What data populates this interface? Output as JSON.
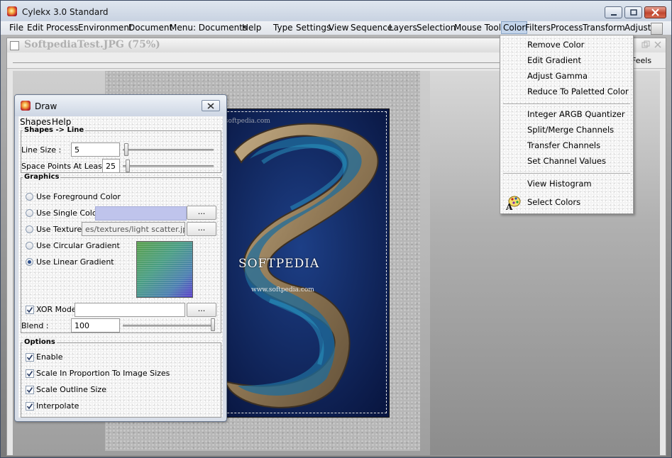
{
  "app": {
    "title": "Cylekx 3.0 Standard"
  },
  "menubar": {
    "items": [
      {
        "label": "File",
        "open": false
      },
      {
        "label": "Edit",
        "open": false
      },
      {
        "label": "Process",
        "open": false
      },
      {
        "label": "Environment",
        "open": false
      },
      {
        "label": "Document",
        "open": false
      },
      {
        "label": "Menu: Documents",
        "open": false
      },
      {
        "label": "Help",
        "open": false
      },
      {
        "label": "Type",
        "open": false
      },
      {
        "label": "Settings",
        "open": false
      },
      {
        "label": "View",
        "open": false
      },
      {
        "label": "Sequence",
        "open": false
      },
      {
        "label": "Layers",
        "open": false
      },
      {
        "label": "Selection",
        "open": false
      },
      {
        "label": "Mouse Tool",
        "open": false
      },
      {
        "label": "Color",
        "open": true
      },
      {
        "label": "Filters",
        "open": false
      },
      {
        "label": "Process",
        "open": false
      },
      {
        "label": "Transform",
        "open": false
      },
      {
        "label": "Adjust",
        "open": false
      }
    ]
  },
  "document": {
    "title": "SoftpediaTest.JPG (75%)",
    "toolbar_text": "Feels",
    "watermark_text": "SOFTPEDIA",
    "watermark_url": "www.softpedia.com"
  },
  "color_menu": {
    "groups": [
      [
        "Remove Color",
        "Edit Gradient",
        "Adjust Gamma",
        "Reduce To Paletted Color"
      ],
      [
        "Integer ARGB Quantizer",
        "Split/Merge Channels",
        "Transfer Channels",
        "Set Channel Values"
      ],
      [
        "View Histogram",
        "Select Colors"
      ]
    ],
    "select_colors_icon": "palette-icon"
  },
  "draw_dialog": {
    "title": "Draw",
    "menu": [
      "Shapes",
      "Help"
    ],
    "line_group": {
      "label": "Shapes -> Line",
      "line_size_label": "Line Size :",
      "line_size_value": "5",
      "line_size_level": 0.02,
      "space_label": "Space Points At Least :",
      "space_value": "25",
      "space_level": 0.02
    },
    "graphics": {
      "label": "Graphics",
      "options": [
        {
          "label": "Use Foreground Color",
          "selected": false
        },
        {
          "label": "Use Single Color",
          "selected": false
        },
        {
          "label": "Use Texture",
          "selected": false
        },
        {
          "label": "Use Circular Gradient",
          "selected": false
        },
        {
          "label": "Use Linear Gradient",
          "selected": true
        }
      ],
      "single_color": "#bfc4ec",
      "texture_path": "es/textures/light scatter.jpg",
      "browse_label": "...",
      "xor_label": "XOR Mode",
      "xor_checked": true,
      "xor_value": "",
      "blend_label": "Blend :",
      "blend_value": "100",
      "blend_level": 1.0
    },
    "options": {
      "label": "Options",
      "items": [
        {
          "label": "Enable",
          "checked": true
        },
        {
          "label": "Scale In Proportion To Image Sizes",
          "checked": true
        },
        {
          "label": "Scale Outline Size",
          "checked": true
        },
        {
          "label": "Interpolate",
          "checked": true
        }
      ]
    }
  }
}
